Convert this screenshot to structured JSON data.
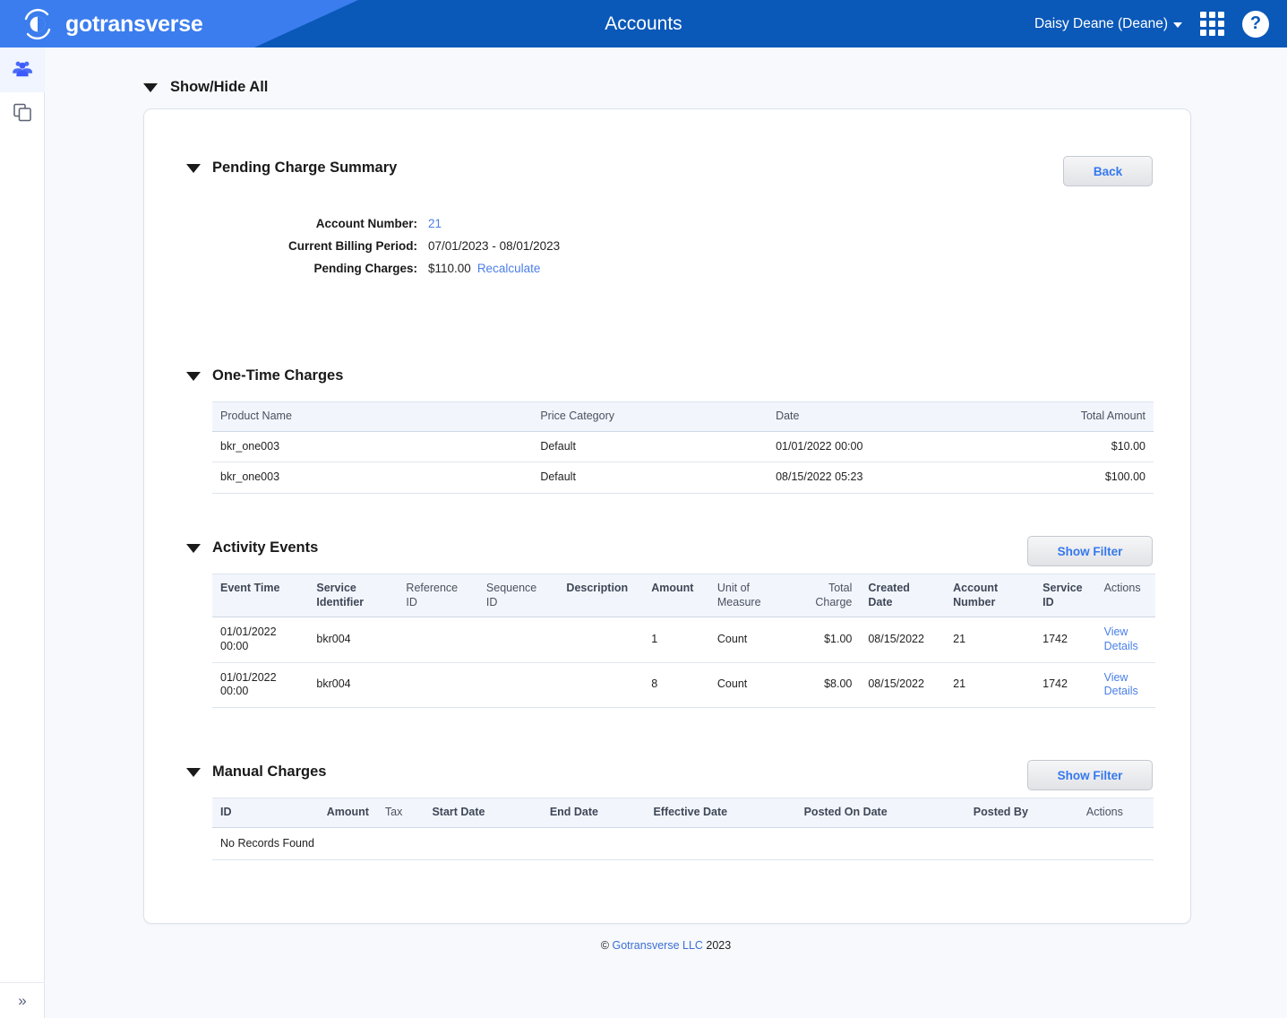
{
  "header": {
    "brand": "gotransverse",
    "title": "Accounts",
    "user": "Daisy Deane (Deane)",
    "apps_icon": "grid-apps-icon",
    "help_icon": "help-circle-icon",
    "help_glyph": "?"
  },
  "sidebar": {
    "items": [
      {
        "name": "accounts",
        "icon": "users-group-icon",
        "active": true
      },
      {
        "name": "documents",
        "icon": "copy-documents-icon",
        "active": false
      }
    ],
    "collapse_glyph": "»"
  },
  "page": {
    "show_hide_all": "Show/Hide All"
  },
  "pending_charge_summary": {
    "title": "Pending Charge Summary",
    "back_label": "Back",
    "fields": [
      {
        "label": "Account Number:",
        "value": "21",
        "is_link": true
      },
      {
        "label": "Current Billing Period:",
        "value": "07/01/2023 - 08/01/2023",
        "is_link": false
      },
      {
        "label": "Pending Charges:",
        "value": "$110.00",
        "is_link": false,
        "action": "Recalculate"
      }
    ]
  },
  "one_time_charges": {
    "title": "One-Time Charges",
    "columns": [
      "Product Name",
      "Price Category",
      "Date",
      "Total Amount"
    ],
    "rows": [
      [
        "bkr_one003",
        "Default",
        "01/01/2022 00:00",
        "$10.00"
      ],
      [
        "bkr_one003",
        "Default",
        "08/15/2022 05:23",
        "$100.00"
      ]
    ]
  },
  "activity_events": {
    "title": "Activity Events",
    "filter_label": "Show Filter",
    "columns": [
      {
        "label": "Event Time",
        "bold": true,
        "align": "left"
      },
      {
        "label": "Service\nIdentifier",
        "bold": true,
        "align": "left"
      },
      {
        "label": "Reference\nID",
        "bold": false,
        "align": "left"
      },
      {
        "label": "Sequence\nID",
        "bold": false,
        "align": "left"
      },
      {
        "label": "Description",
        "bold": true,
        "align": "left"
      },
      {
        "label": "Amount",
        "bold": true,
        "align": "left"
      },
      {
        "label": "Unit of\nMeasure",
        "bold": false,
        "align": "left"
      },
      {
        "label": "Total\nCharge",
        "bold": false,
        "align": "right"
      },
      {
        "label": "Created\nDate",
        "bold": true,
        "align": "left"
      },
      {
        "label": "Account\nNumber",
        "bold": true,
        "align": "left"
      },
      {
        "label": "Service\nID",
        "bold": true,
        "align": "left"
      },
      {
        "label": "Actions",
        "bold": false,
        "align": "left"
      }
    ],
    "rows": [
      {
        "event_time": "01/01/2022\n00:00",
        "service_identifier": "bkr004",
        "reference_id": "",
        "sequence_id": "",
        "description": "",
        "amount": "1",
        "unit_of_measure": "Count",
        "total_charge": "$1.00",
        "created_date": "08/15/2022",
        "account_number": "21",
        "service_id": "1742",
        "action": "View\nDetails"
      },
      {
        "event_time": "01/01/2022\n00:00",
        "service_identifier": "bkr004",
        "reference_id": "",
        "sequence_id": "",
        "description": "",
        "amount": "8",
        "unit_of_measure": "Count",
        "total_charge": "$8.00",
        "created_date": "08/15/2022",
        "account_number": "21",
        "service_id": "1742",
        "action": "View\nDetails"
      }
    ]
  },
  "manual_charges": {
    "title": "Manual Charges",
    "filter_label": "Show Filter",
    "columns": [
      {
        "label": "ID",
        "bold": true,
        "align": "left"
      },
      {
        "label": "Amount",
        "bold": true,
        "align": "right"
      },
      {
        "label": "Tax",
        "bold": false,
        "align": "left"
      },
      {
        "label": "Start Date",
        "bold": true,
        "align": "left"
      },
      {
        "label": "End Date",
        "bold": true,
        "align": "left"
      },
      {
        "label": "Effective Date",
        "bold": true,
        "align": "left"
      },
      {
        "label": "Posted On Date",
        "bold": true,
        "align": "left"
      },
      {
        "label": "Posted By",
        "bold": true,
        "align": "left"
      },
      {
        "label": "Actions",
        "bold": false,
        "align": "left"
      }
    ],
    "empty_message": "No Records Found"
  },
  "footer": {
    "copyright_mark": "©",
    "company": "Gotransverse LLC",
    "year": "2023"
  },
  "colors": {
    "header_dark": "#0a58b8",
    "header_light": "#3b7dee",
    "link": "#4a7fe8",
    "page_bg": "#f7f9fc",
    "table_head_bg": "#f2f6fc"
  }
}
